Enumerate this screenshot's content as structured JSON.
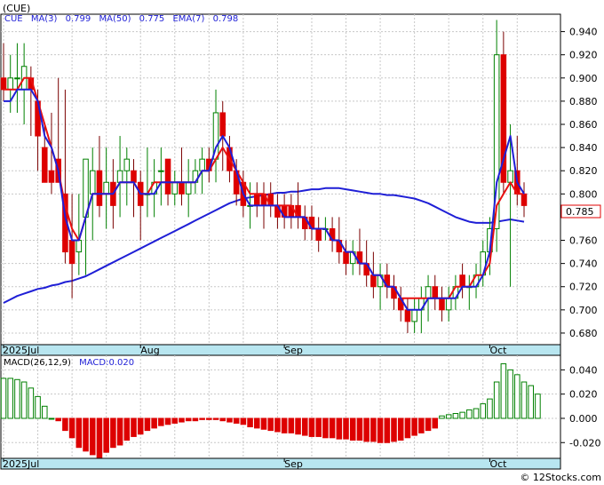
{
  "title": "(CUE)",
  "legend": {
    "ticker": "CUE",
    "ma3_label": "MA(3)",
    "ma3_value": "0.799",
    "ma50_label": "MA(50)",
    "ma50_value": "0.775",
    "ema7_label": "EMA(7)",
    "ema7_value": "0.798"
  },
  "macd_legend": {
    "label": "MACD(26,12,9)",
    "value_label": "MACD:0.020"
  },
  "last_price_label": "0.785",
  "watermark": "© 12Stocks.com",
  "colors": {
    "up_candle": "#008000",
    "down_candle": "#dd0000",
    "ma3": "#1f1fd6",
    "ma50": "#1f1fd6",
    "ema7": "#e81010",
    "macd_pos": "#008000",
    "macd_neg": "#dd0000",
    "date_band": "#b8e6f0",
    "last_price_box": "#e00000"
  },
  "chart_data": [
    {
      "type": "candlestick",
      "title": "(CUE)",
      "ylim": [
        0.67,
        0.955
      ],
      "yticks": [
        "0.940",
        "0.920",
        "0.900",
        "0.880",
        "0.860",
        "0.840",
        "0.820",
        "0.800",
        "0.760",
        "0.740",
        "0.720",
        "0.700",
        "0.680"
      ],
      "x_labels": [
        {
          "label": "2025Jul",
          "index": 0
        },
        {
          "label": "Aug",
          "index": 20
        },
        {
          "label": "Sep",
          "index": 41
        },
        {
          "label": "Oct",
          "index": 71
        }
      ],
      "grid": true,
      "candles": [
        [
          0.9,
          0.93,
          0.88,
          0.89
        ],
        [
          0.89,
          0.92,
          0.87,
          0.9
        ],
        [
          0.9,
          0.93,
          0.87,
          0.9
        ],
        [
          0.89,
          0.93,
          0.86,
          0.91
        ],
        [
          0.9,
          0.91,
          0.85,
          0.89
        ],
        [
          0.88,
          0.89,
          0.82,
          0.85
        ],
        [
          0.84,
          0.86,
          0.81,
          0.81
        ],
        [
          0.82,
          0.87,
          0.8,
          0.81
        ],
        [
          0.83,
          0.9,
          0.81,
          0.81
        ],
        [
          0.8,
          0.89,
          0.74,
          0.75
        ],
        [
          0.76,
          0.8,
          0.71,
          0.74
        ],
        [
          0.75,
          0.8,
          0.73,
          0.76
        ],
        [
          0.78,
          0.83,
          0.73,
          0.83
        ],
        [
          0.8,
          0.84,
          0.76,
          0.82
        ],
        [
          0.82,
          0.85,
          0.78,
          0.79
        ],
        [
          0.8,
          0.84,
          0.77,
          0.81
        ],
        [
          0.81,
          0.83,
          0.77,
          0.79
        ],
        [
          0.81,
          0.85,
          0.78,
          0.82
        ],
        [
          0.82,
          0.84,
          0.79,
          0.83
        ],
        [
          0.82,
          0.83,
          0.78,
          0.81
        ],
        [
          0.81,
          0.82,
          0.76,
          0.79
        ],
        [
          0.8,
          0.84,
          0.78,
          0.8
        ],
        [
          0.8,
          0.83,
          0.78,
          0.81
        ],
        [
          0.82,
          0.84,
          0.79,
          0.82
        ],
        [
          0.83,
          0.83,
          0.79,
          0.8
        ],
        [
          0.8,
          0.82,
          0.79,
          0.81
        ],
        [
          0.81,
          0.84,
          0.79,
          0.8
        ],
        [
          0.8,
          0.83,
          0.78,
          0.81
        ],
        [
          0.81,
          0.83,
          0.8,
          0.82
        ],
        [
          0.82,
          0.84,
          0.8,
          0.83
        ],
        [
          0.83,
          0.84,
          0.81,
          0.82
        ],
        [
          0.83,
          0.89,
          0.81,
          0.87
        ],
        [
          0.87,
          0.88,
          0.82,
          0.85
        ],
        [
          0.84,
          0.85,
          0.81,
          0.82
        ],
        [
          0.82,
          0.83,
          0.79,
          0.8
        ],
        [
          0.81,
          0.82,
          0.78,
          0.79
        ],
        [
          0.79,
          0.81,
          0.77,
          0.79
        ],
        [
          0.8,
          0.81,
          0.78,
          0.79
        ],
        [
          0.8,
          0.81,
          0.77,
          0.79
        ],
        [
          0.8,
          0.81,
          0.78,
          0.79
        ],
        [
          0.79,
          0.8,
          0.77,
          0.78
        ],
        [
          0.79,
          0.8,
          0.77,
          0.78
        ],
        [
          0.79,
          0.8,
          0.77,
          0.78
        ],
        [
          0.79,
          0.81,
          0.77,
          0.78
        ],
        [
          0.78,
          0.79,
          0.76,
          0.77
        ],
        [
          0.78,
          0.79,
          0.76,
          0.77
        ],
        [
          0.77,
          0.78,
          0.75,
          0.76
        ],
        [
          0.77,
          0.78,
          0.76,
          0.77
        ],
        [
          0.77,
          0.78,
          0.75,
          0.76
        ],
        [
          0.76,
          0.78,
          0.74,
          0.75
        ],
        [
          0.75,
          0.76,
          0.73,
          0.74
        ],
        [
          0.74,
          0.76,
          0.73,
          0.75
        ],
        [
          0.75,
          0.77,
          0.73,
          0.74
        ],
        [
          0.74,
          0.76,
          0.72,
          0.73
        ],
        [
          0.73,
          0.75,
          0.71,
          0.72
        ],
        [
          0.72,
          0.74,
          0.7,
          0.73
        ],
        [
          0.73,
          0.74,
          0.71,
          0.72
        ],
        [
          0.72,
          0.73,
          0.7,
          0.71
        ],
        [
          0.71,
          0.72,
          0.69,
          0.7
        ],
        [
          0.7,
          0.71,
          0.68,
          0.69
        ],
        [
          0.69,
          0.71,
          0.68,
          0.7
        ],
        [
          0.7,
          0.72,
          0.68,
          0.71
        ],
        [
          0.71,
          0.73,
          0.69,
          0.72
        ],
        [
          0.72,
          0.73,
          0.7,
          0.71
        ],
        [
          0.71,
          0.72,
          0.69,
          0.7
        ],
        [
          0.7,
          0.72,
          0.69,
          0.71
        ],
        [
          0.71,
          0.73,
          0.7,
          0.72
        ],
        [
          0.73,
          0.74,
          0.71,
          0.72
        ],
        [
          0.72,
          0.73,
          0.7,
          0.72
        ],
        [
          0.72,
          0.74,
          0.71,
          0.73
        ],
        [
          0.73,
          0.76,
          0.72,
          0.75
        ],
        [
          0.75,
          0.78,
          0.73,
          0.77
        ],
        [
          0.77,
          0.95,
          0.75,
          0.92
        ],
        [
          0.92,
          0.94,
          0.8,
          0.81
        ],
        [
          0.81,
          0.86,
          0.72,
          0.82
        ],
        [
          0.82,
          0.85,
          0.79,
          0.8
        ],
        [
          0.8,
          0.81,
          0.78,
          0.79
        ]
      ],
      "ma3": [
        0.88,
        0.88,
        0.89,
        0.89,
        0.89,
        0.88,
        0.85,
        0.84,
        0.82,
        0.78,
        0.76,
        0.76,
        0.78,
        0.8,
        0.8,
        0.8,
        0.8,
        0.81,
        0.81,
        0.81,
        0.8,
        0.8,
        0.8,
        0.81,
        0.81,
        0.81,
        0.81,
        0.81,
        0.81,
        0.82,
        0.82,
        0.84,
        0.85,
        0.84,
        0.82,
        0.8,
        0.79,
        0.79,
        0.79,
        0.79,
        0.79,
        0.78,
        0.78,
        0.78,
        0.78,
        0.77,
        0.77,
        0.77,
        0.76,
        0.76,
        0.75,
        0.75,
        0.74,
        0.74,
        0.73,
        0.73,
        0.72,
        0.72,
        0.71,
        0.7,
        0.7,
        0.7,
        0.71,
        0.71,
        0.71,
        0.71,
        0.71,
        0.72,
        0.72,
        0.72,
        0.73,
        0.75,
        0.81,
        0.83,
        0.85,
        0.81,
        0.8
      ],
      "ma50": [
        0.706,
        0.709,
        0.712,
        0.714,
        0.716,
        0.718,
        0.719,
        0.721,
        0.722,
        0.724,
        0.725,
        0.727,
        0.729,
        0.732,
        0.735,
        0.738,
        0.741,
        0.744,
        0.747,
        0.75,
        0.753,
        0.756,
        0.759,
        0.762,
        0.765,
        0.768,
        0.771,
        0.774,
        0.777,
        0.78,
        0.783,
        0.786,
        0.789,
        0.792,
        0.794,
        0.796,
        0.797,
        0.798,
        0.799,
        0.8,
        0.801,
        0.801,
        0.802,
        0.802,
        0.803,
        0.804,
        0.804,
        0.805,
        0.805,
        0.805,
        0.804,
        0.803,
        0.802,
        0.801,
        0.8,
        0.8,
        0.799,
        0.799,
        0.798,
        0.797,
        0.796,
        0.794,
        0.792,
        0.789,
        0.786,
        0.783,
        0.78,
        0.778,
        0.776,
        0.775,
        0.775,
        0.775,
        0.776,
        0.777,
        0.778,
        0.777,
        0.776
      ],
      "ema7": [
        0.89,
        0.89,
        0.89,
        0.9,
        0.9,
        0.88,
        0.86,
        0.84,
        0.82,
        0.79,
        0.77,
        0.76,
        0.78,
        0.8,
        0.8,
        0.8,
        0.8,
        0.81,
        0.81,
        0.81,
        0.8,
        0.8,
        0.81,
        0.81,
        0.81,
        0.81,
        0.81,
        0.81,
        0.81,
        0.82,
        0.82,
        0.83,
        0.84,
        0.83,
        0.82,
        0.81,
        0.8,
        0.8,
        0.8,
        0.79,
        0.79,
        0.79,
        0.79,
        0.78,
        0.78,
        0.77,
        0.77,
        0.77,
        0.76,
        0.76,
        0.75,
        0.75,
        0.74,
        0.74,
        0.73,
        0.73,
        0.72,
        0.72,
        0.71,
        0.71,
        0.71,
        0.71,
        0.71,
        0.71,
        0.71,
        0.71,
        0.72,
        0.72,
        0.72,
        0.73,
        0.73,
        0.74,
        0.79,
        0.8,
        0.81,
        0.8,
        0.8
      ]
    },
    {
      "type": "bar",
      "title": "MACD(26,12,9)",
      "ylim": [
        -0.033,
        0.052
      ],
      "yticks": [
        "0.040",
        "0.020",
        "0.000",
        "-0.020"
      ],
      "x_labels": [
        {
          "label": "2025Jul",
          "index": 0
        },
        {
          "label": "Sep",
          "index": 41
        },
        {
          "label": "Oct",
          "index": 71
        }
      ],
      "values": [
        0.033,
        0.033,
        0.032,
        0.03,
        0.025,
        0.018,
        0.01,
        0.0,
        -0.002,
        -0.01,
        -0.016,
        -0.024,
        -0.027,
        -0.03,
        -0.033,
        -0.028,
        -0.024,
        -0.022,
        -0.018,
        -0.015,
        -0.013,
        -0.01,
        -0.008,
        -0.006,
        -0.005,
        -0.004,
        -0.003,
        -0.002,
        -0.002,
        -0.001,
        -0.001,
        -0.001,
        -0.002,
        -0.003,
        -0.004,
        -0.005,
        -0.007,
        -0.008,
        -0.009,
        -0.01,
        -0.011,
        -0.012,
        -0.012,
        -0.013,
        -0.014,
        -0.015,
        -0.015,
        -0.016,
        -0.016,
        -0.017,
        -0.017,
        -0.018,
        -0.018,
        -0.019,
        -0.019,
        -0.02,
        -0.02,
        -0.019,
        -0.018,
        -0.016,
        -0.014,
        -0.012,
        -0.01,
        -0.008,
        0.002,
        0.003,
        0.004,
        0.005,
        0.007,
        0.008,
        0.012,
        0.016,
        0.03,
        0.045,
        0.04,
        0.036,
        0.03,
        0.027,
        0.02
      ]
    }
  ]
}
